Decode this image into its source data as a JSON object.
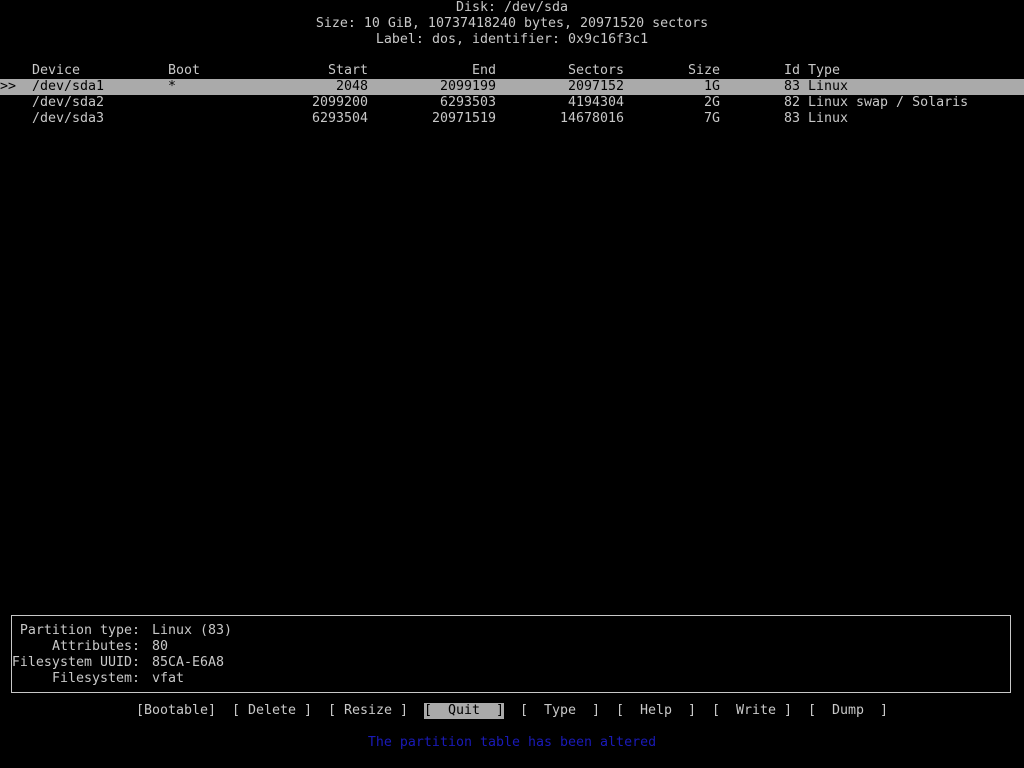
{
  "header": {
    "disk_line": "Disk: /dev/sda",
    "size_line": "Size: 10 GiB, 10737418240 bytes, 20971520 sectors",
    "label_line": "Label: dos, identifier: 0x9c16f3c1"
  },
  "table": {
    "columns": {
      "device": "Device",
      "boot": "Boot",
      "start": "Start",
      "end": "End",
      "sectors": "Sectors",
      "size": "Size",
      "id": "Id",
      "type": "Type"
    },
    "cursor": ">>",
    "rows": [
      {
        "device": "/dev/sda1",
        "boot": "*",
        "start": "2048",
        "end": "2099199",
        "sectors": "2097152",
        "size": "1G",
        "id": "83",
        "type": "Linux"
      },
      {
        "device": "/dev/sda2",
        "boot": "",
        "start": "2099200",
        "end": "6293503",
        "sectors": "4194304",
        "size": "2G",
        "id": "82",
        "type": "Linux swap / Solaris"
      },
      {
        "device": "/dev/sda3",
        "boot": "",
        "start": "6293504",
        "end": "20971519",
        "sectors": "14678016",
        "size": "7G",
        "id": "83",
        "type": "Linux"
      }
    ]
  },
  "info": {
    "partition_type_label": "Partition type:",
    "partition_type_value": "Linux (83)",
    "attributes_label": "Attributes:",
    "attributes_value": "80",
    "fs_uuid_label": "Filesystem UUID:",
    "fs_uuid_value": "85CA-E6A8",
    "filesystem_label": "Filesystem:",
    "filesystem_value": "vfat"
  },
  "menu": {
    "bootable": "[Bootable]",
    "delete": "[ Delete ]",
    "resize": "[ Resize ]",
    "quit": "[  Quit  ]",
    "type": "[  Type  ]",
    "help": "[  Help  ]",
    "write": "[  Write ]",
    "dump": "[  Dump  ]"
  },
  "status": "The partition table has been altered",
  "colors": {
    "background": "#000000",
    "foreground": "#c8c8c8",
    "highlight": "#aaaaaa",
    "status": "#1a1ab8"
  }
}
